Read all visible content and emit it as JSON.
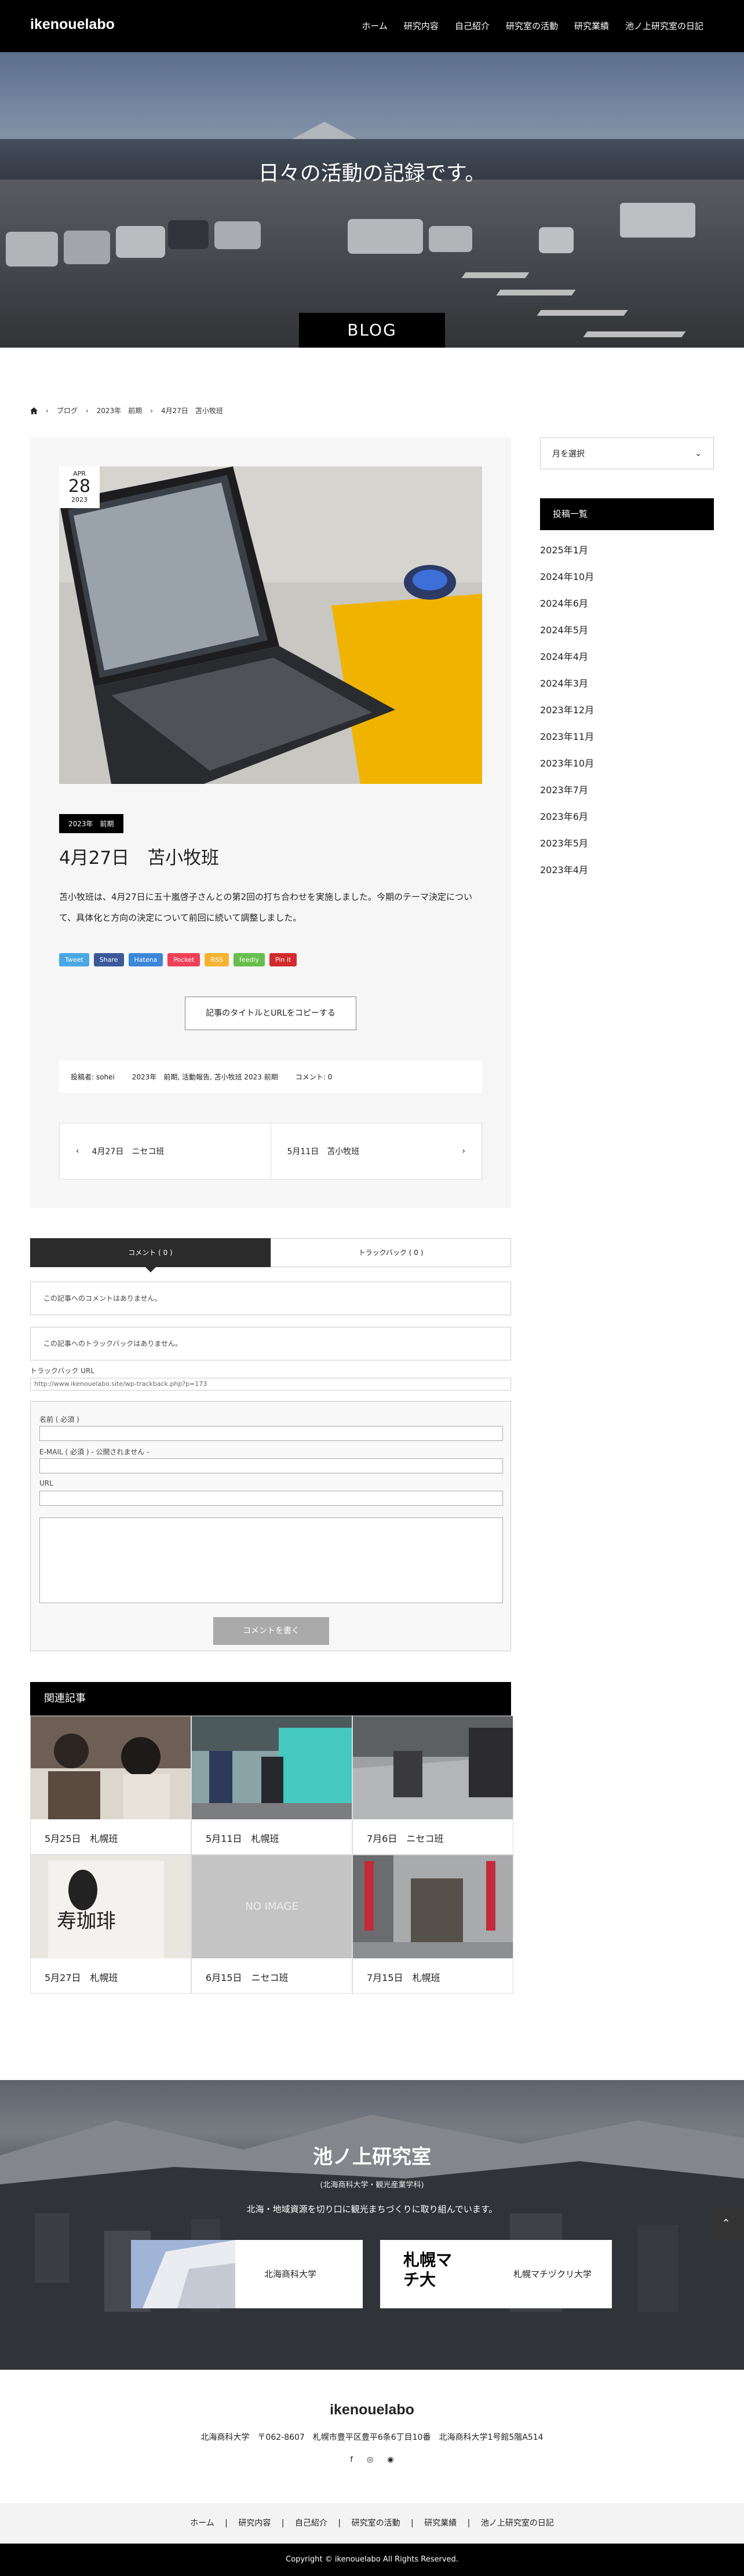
{
  "site": {
    "logo": "ikenouelabo"
  },
  "nav": [
    "ホーム",
    "研究内容",
    "自己紹介",
    "研究室の活動",
    "研究業績",
    "池ノ上研究室の日記"
  ],
  "hero": {
    "headline": "日々の活動の記録です。",
    "section_label": "BLOG"
  },
  "breadcrumb": [
    "ブログ",
    "2023年　前期",
    "4月27日　苫小牧班"
  ],
  "post": {
    "date_month": "APR",
    "date_day": "28",
    "date_year": "2023",
    "category": "2023年　前期",
    "title": "4月27日　苫小牧班",
    "body": "苫小牧班は、4月27日に五十嵐啓子さんとの第2回の打ち合わせを実施しました。今期のテーマ決定について、具体化と方向の決定について前回に続いて調整しました。",
    "share": [
      "Tweet",
      "Share",
      "Hatena",
      "Pocket",
      "RSS",
      "feedly",
      "Pin it"
    ],
    "copy_button": "記事のタイトルとURLをコピーする",
    "meta_author": "投稿者: sohei",
    "meta_tags": "2023年　前期, 活動報告, 苫小牧班 2023 前期",
    "meta_comments": "コメント: 0",
    "prev": "4月27日　ニセコ班",
    "next": "5月11日　苫小牧班"
  },
  "sidebar": {
    "select_label": "月を選択",
    "archive_heading": "投稿一覧",
    "archive": [
      "2025年1月",
      "2024年10月",
      "2024年6月",
      "2024年5月",
      "2024年4月",
      "2024年3月",
      "2023年12月",
      "2023年11月",
      "2023年10月",
      "2023年7月",
      "2023年6月",
      "2023年5月",
      "2023年4月"
    ]
  },
  "comments": {
    "tab_comment": "コメント ( 0 )",
    "tab_trackback": "トラックバック ( 0 )",
    "no_comment": "この記事へのコメントはありません。",
    "no_trackback": "この記事へのトラックバックはありません。",
    "trackback_label": "トラックバック URL",
    "trackback_url": "http://www.ikenouelabo.site/wp-trackback.php?p=173",
    "name_label": "名前 ( 必須 )",
    "email_label": "E-MAIL ( 必須 ) - 公開されません -",
    "url_label": "URL",
    "submit": "コメントを書く"
  },
  "related": {
    "heading": "関連記事",
    "items": [
      "5月25日　札幌班",
      "5月11日　札幌班",
      "7月6日　ニセコ班",
      "5月27日　札幌班",
      "6月15日　ニセコ班",
      "7月15日　札幌班"
    ],
    "noimage": "NO IMAGE",
    "sign_text": "寿珈琲"
  },
  "footer_hero": {
    "title": "池ノ上研究室",
    "subtitle": "(北海商科大学・観光産業学科)",
    "desc": "北海・地域資源を切り口に観光まちづくりに取り組んでいます。",
    "card1": "北海商科大学",
    "card2": "札幌マチヅクリ大学",
    "logo2_text": "札幌マチ大"
  },
  "footer": {
    "logo": "ikenouelabo",
    "address": "北海商科大学　〒062-8607　札幌市豊平区豊平6条6丁目10番　北海商科大学1号館5階A514",
    "social": [
      "facebook-icon",
      "instagram-icon",
      "rss-icon"
    ],
    "nav": [
      "ホーム",
      "研究内容",
      "自己紹介",
      "研究室の活動",
      "研究業績",
      "池ノ上研究室の日記"
    ],
    "copyright": "Copyright © ikenouelabo All Rights Reserved."
  }
}
